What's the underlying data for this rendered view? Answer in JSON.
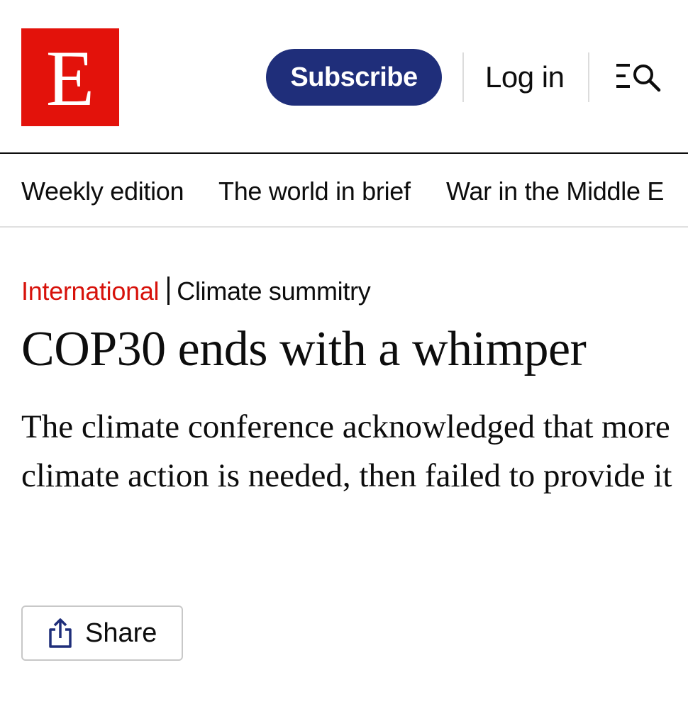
{
  "header": {
    "logo_letter": "E",
    "subscribe_label": "Subscribe",
    "login_label": "Log in",
    "menu_search_icon": "menu-search-icon"
  },
  "nav": {
    "items": [
      {
        "label": "Weekly edition"
      },
      {
        "label": "The world in brief"
      },
      {
        "label": "War in the Middle E"
      }
    ]
  },
  "article": {
    "section": "International",
    "topic": "Climate summitry",
    "headline": "COP30 ends with a whimper",
    "standfirst": "The climate conference acknowledged that more climate action is needed, then failed to provide it",
    "share_label": "Share",
    "share_icon": "share-icon"
  },
  "colors": {
    "brand_red": "#e3120b",
    "section_red": "#d7120b",
    "subscribe_blue": "#1f2e7a",
    "share_icon_blue": "#1f2e7a"
  }
}
